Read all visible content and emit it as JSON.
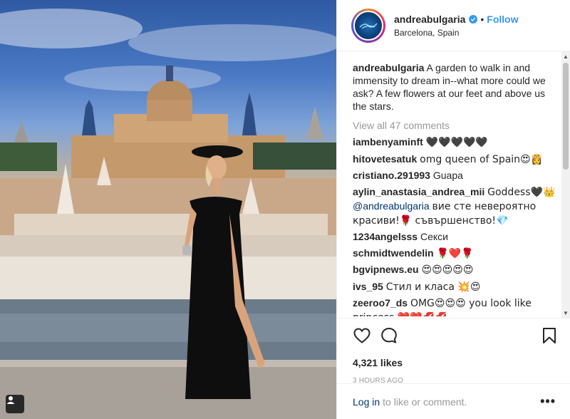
{
  "post": {
    "username": "andreabulgaria",
    "follow_separator": "•",
    "follow_label": "Follow",
    "location": "Barcelona, Spain",
    "caption_user": "andreabulgaria",
    "caption_text": "A garden to walk in and immensity to dream in--what more could we ask? A few flowers at our feet and above us the stars.",
    "view_all": "View all 47 comments",
    "likes": "4,321 likes",
    "time": "3 HOURS AGO"
  },
  "comments": [
    {
      "user": "iambenyaminft",
      "text": "🖤🖤🖤🖤🖤"
    },
    {
      "user": "hitovetesatuk",
      "text": "omg queen of Spain😍👸"
    },
    {
      "user": "cristiano.291993",
      "text": "Guapa"
    },
    {
      "user": "aylin_anastasia_andrea_mii",
      "text": "Goddess🖤👑",
      "mention": "@andreabulgaria",
      "text2": "вие сте невероятно красиви!🌹 съвършенство!💎"
    },
    {
      "user": "1234angelsss",
      "text": "Секси"
    },
    {
      "user": "schmidtwendelin",
      "text": "🌹❤️🌹"
    },
    {
      "user": "bgvipnews.eu",
      "text": "😍😍😍😍😍"
    },
    {
      "user": "ivs_95",
      "text": "Стил и класа 💥😍"
    },
    {
      "user": "zeeroo7_ds",
      "text": "OMG😍😍😍 you look like princess ❤️❤️💋💋"
    }
  ],
  "footer": {
    "login": "Log in",
    "rest": "to like or comment.",
    "more": "•••"
  },
  "colors": {
    "link_blue": "#3897f0",
    "muted": "#999999",
    "mention": "#003569"
  },
  "icons": [
    "heart-icon",
    "comment-icon",
    "bookmark-icon",
    "verified-icon",
    "user-tag-icon",
    "more-icon"
  ]
}
